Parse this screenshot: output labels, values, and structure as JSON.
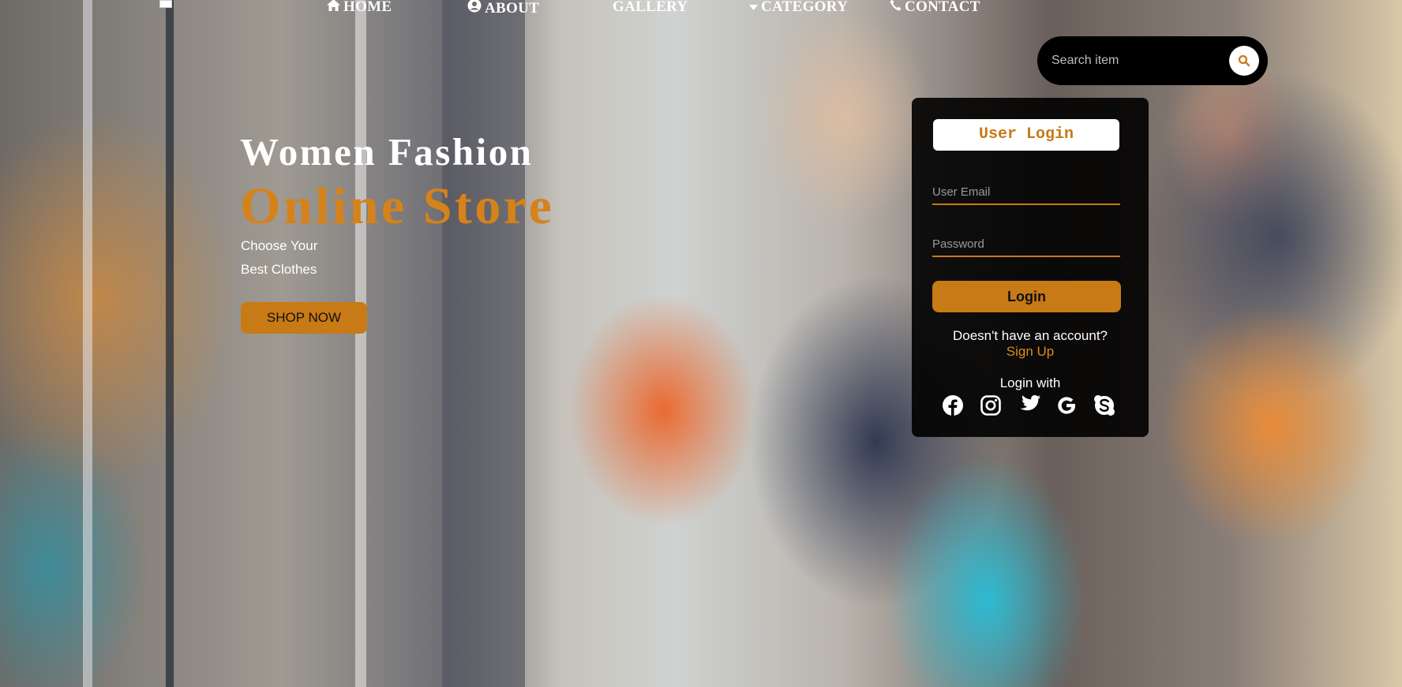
{
  "nav": {
    "home": "HOME",
    "about": "ABOUT",
    "gallery": "GALLERY",
    "category": "CATEGORY",
    "contact": "CONTACT"
  },
  "search": {
    "placeholder": "Search item"
  },
  "hero": {
    "title_line1": "Women Fashion",
    "title_line2": "Online Store",
    "subtitle_line1": "Choose Your",
    "subtitle_line2": "Best Clothes",
    "shop_button": "SHOP NOW"
  },
  "login": {
    "title": "User Login",
    "email_placeholder": "User Email",
    "password_placeholder": "Password",
    "login_button": "Login",
    "no_account_text": "Doesn't have an account?",
    "signup_link": "Sign Up",
    "login_with_text": "Login with",
    "social_icons": [
      "facebook-icon",
      "instagram-icon",
      "twitter-icon",
      "google-icon",
      "skype-icon"
    ]
  },
  "colors": {
    "accent": "#c77a16",
    "accent_text": "#d6821a",
    "panel_bg": "#000000"
  }
}
